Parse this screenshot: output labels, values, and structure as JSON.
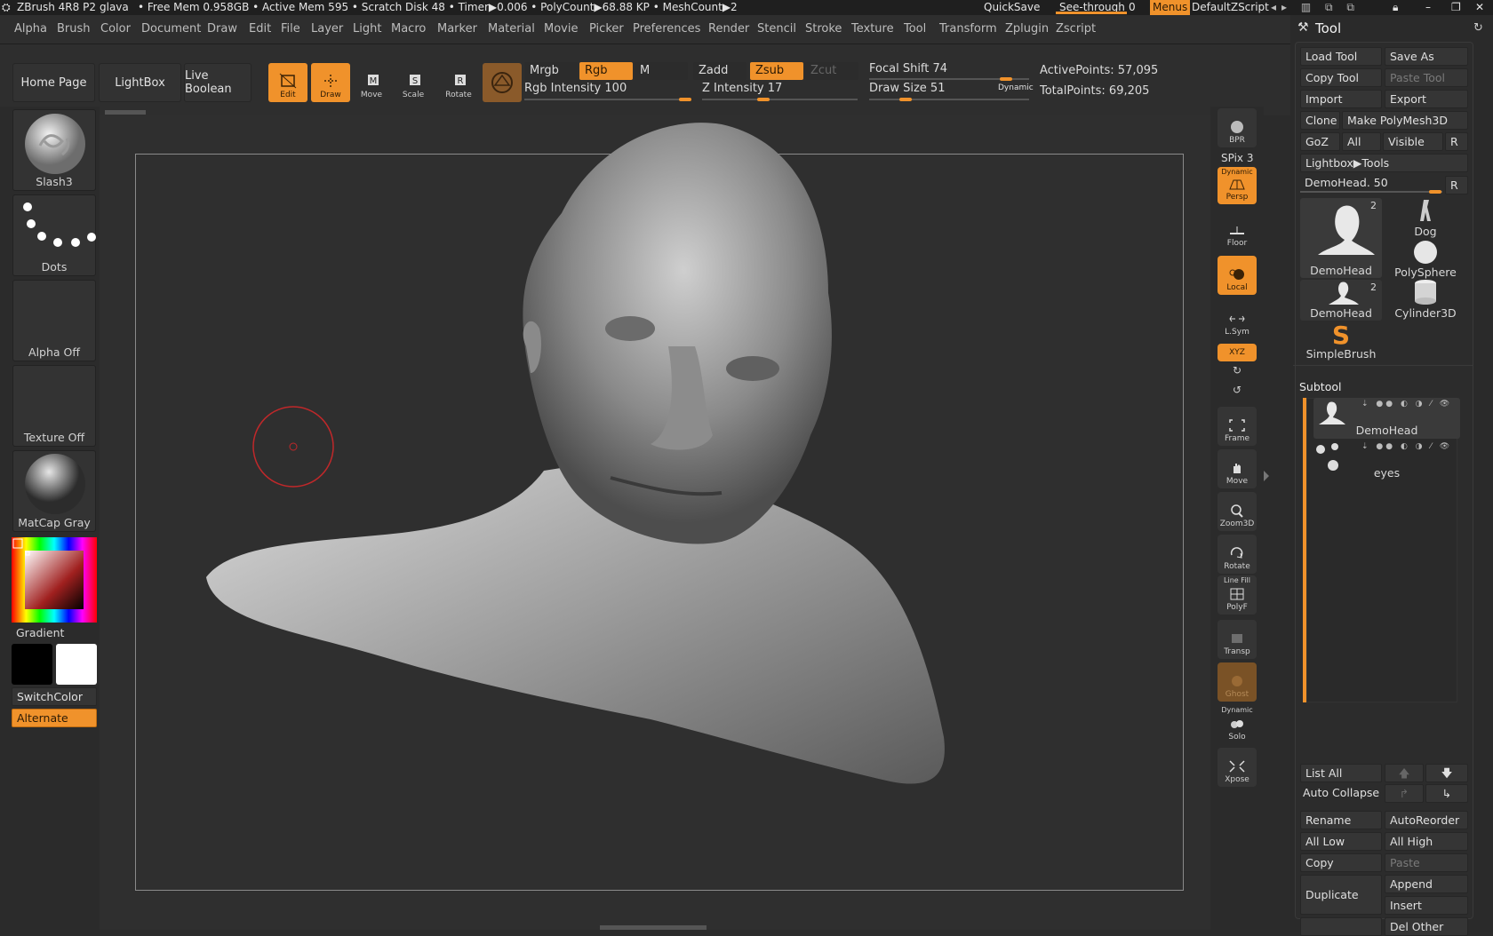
{
  "titlebar": {
    "app": "ZBrush 4R8 P2",
    "project": "glava",
    "stats": "• Free Mem 0.958GB • Active Mem 595 • Scratch Disk 48 • Timer▶0.006 • PolyCount▶68.88 KP • MeshCount▶2",
    "quicksave": "QuickSave",
    "seethrough": "See-through",
    "seethrough_val": "0",
    "menus": "Menus",
    "zscript": "DefaultZScript"
  },
  "menubar": [
    "Alpha",
    "Brush",
    "Color",
    "Document",
    "Draw",
    "Edit",
    "File",
    "Layer",
    "Light",
    "Macro",
    "Marker",
    "Material",
    "Movie",
    "Picker",
    "Preferences",
    "Render",
    "Stencil",
    "Stroke",
    "Texture",
    "Tool",
    "Transform",
    "Zplugin",
    "Zscript"
  ],
  "toolbar": {
    "home": "Home Page",
    "lightbox": "LightBox",
    "liveboolean": "Live Boolean",
    "edit": "Edit",
    "draw": "Draw",
    "move": "Move",
    "scale": "Scale",
    "rotate": "Rotate",
    "mrgb": "Mrgb",
    "rgb": "Rgb",
    "m": "M",
    "zadd": "Zadd",
    "zsub": "Zsub",
    "zcut": "Zcut",
    "rgb_intensity_label": "Rgb Intensity",
    "rgb_intensity": "100",
    "z_intensity_label": "Z Intensity",
    "z_intensity": "17",
    "focal_shift_label": "Focal Shift",
    "focal_shift": "74",
    "draw_size_label": "Draw Size",
    "draw_size": "51",
    "dynamic": "Dynamic",
    "active_points": "ActivePoints: 57,095",
    "total_points": "TotalPoints: 69,205"
  },
  "leftpanel": {
    "brush": "Slash3",
    "stroke": "Dots",
    "alpha": "Alpha Off",
    "texture": "Texture Off",
    "material": "MatCap Gray",
    "gradient": "Gradient",
    "switchcolor": "SwitchColor",
    "alternate": "Alternate"
  },
  "rightstrip": {
    "bpr": "BPR",
    "spix": "SPix 3",
    "dynamic": "Dynamic",
    "persp": "Persp",
    "floor": "Floor",
    "local": "Local",
    "lsym": "L.Sym",
    "xyz": "XYZ",
    "frame": "Frame",
    "move": "Move",
    "zoom3d": "Zoom3D",
    "rotate": "Rotate",
    "linefill": "Line Fill",
    "polyf": "PolyF",
    "transp": "Transp",
    "ghost": "Ghost",
    "dynamic2": "Dynamic",
    "solo": "Solo",
    "xpose": "Xpose"
  },
  "toolpanel": {
    "title": "Tool",
    "load_tool": "Load Tool",
    "save_as": "Save As",
    "copy_tool": "Copy Tool",
    "paste_tool": "Paste Tool",
    "import": "Import",
    "export": "Export",
    "clone": "Clone",
    "make_polymesh": "Make PolyMesh3D",
    "goz": "GoZ",
    "all": "All",
    "visible": "Visible",
    "r": "R",
    "lightbox_tools": "Lightbox▶Tools",
    "demohead_slider": "DemoHead. 50",
    "tools": [
      {
        "name": "DemoHead",
        "count": "2"
      },
      {
        "name": "Dog",
        "count": ""
      },
      {
        "name": "PolySphere",
        "count": ""
      },
      {
        "name": "DemoHead",
        "count": "2"
      },
      {
        "name": "Cylinder3D",
        "count": ""
      },
      {
        "name": "SimpleBrush",
        "count": ""
      }
    ],
    "subtool_title": "Subtool",
    "subtools": [
      "DemoHead",
      "eyes"
    ],
    "list_all": "List All",
    "auto_collapse": "Auto Collapse",
    "rename": "Rename",
    "autoreorder": "AutoReorder",
    "all_low": "All Low",
    "all_high": "All High",
    "copy": "Copy",
    "paste": "Paste",
    "duplicate": "Duplicate",
    "append": "Append",
    "insert": "Insert",
    "del_other": "Del Other"
  },
  "colors": {
    "accent": "#f0922b",
    "bg": "#2b2b2b"
  }
}
